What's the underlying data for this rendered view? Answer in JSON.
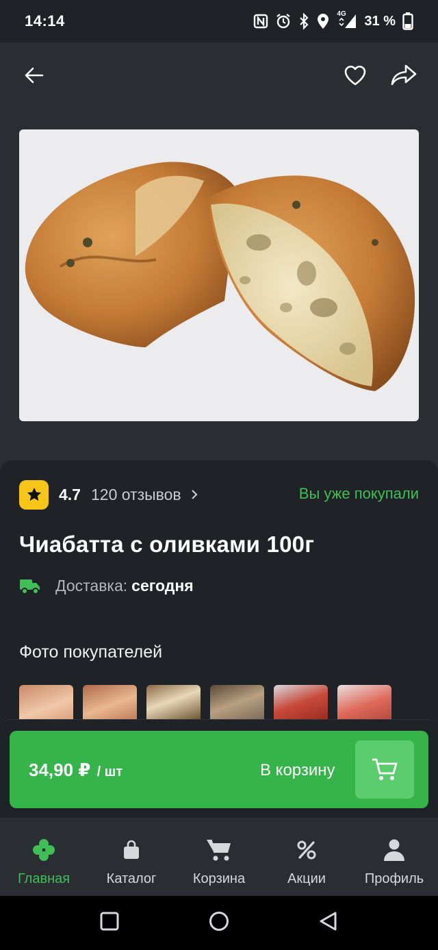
{
  "status_bar": {
    "time": "14:14",
    "network": "4G",
    "battery": "31 %",
    "icons": [
      "nfc-icon",
      "alarm-icon",
      "bluetooth-icon",
      "location-icon",
      "signal-icon",
      "battery-icon"
    ]
  },
  "header": {
    "icons": [
      "back-arrow-icon",
      "heart-icon",
      "share-icon"
    ]
  },
  "product": {
    "image": "ciabatta-bread-photo",
    "rating": "4.7",
    "reviews": "120 отзывов",
    "bought_badge": "Вы уже покупали",
    "title": "Чиабатта с оливками 100г",
    "delivery_label": "Доставка:",
    "delivery_value": "сегодня",
    "photos_heading": "Фото покупателей",
    "customer_photos": 6
  },
  "cart": {
    "price": "34,90 ₽",
    "unit": "/ шт",
    "add_label": "В корзину"
  },
  "nav": {
    "items": [
      {
        "label": "Главная",
        "icon": "clover-icon",
        "active": true
      },
      {
        "label": "Каталог",
        "icon": "bag-icon",
        "active": false
      },
      {
        "label": "Корзина",
        "icon": "cart-icon",
        "active": false
      },
      {
        "label": "Акции",
        "icon": "percent-icon",
        "active": false
      },
      {
        "label": "Профиль",
        "icon": "person-icon",
        "active": false
      }
    ]
  },
  "colors": {
    "accent_green": "#35b44a",
    "rating_yellow": "#f5c518",
    "background": "#2a2e33",
    "sheet": "#1f2226"
  }
}
